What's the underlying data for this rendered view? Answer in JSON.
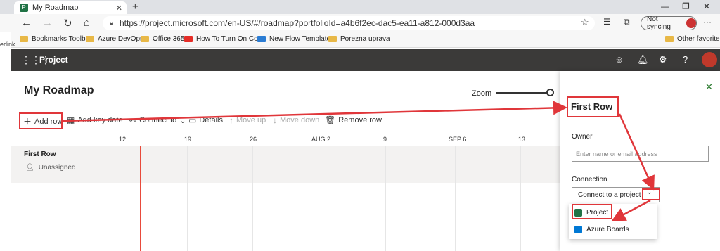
{
  "browser": {
    "tab_title": "My Roadmap",
    "tab_close": "✕",
    "new_tab": "+",
    "url": "https://project.microsoft.com/en-US/#/roadmap?portfolioId=a4b6f2ec-dac5-ea11-a812-000d3aa",
    "sync_label": "Not syncing",
    "more": "···",
    "left_text": "erlink",
    "bookmarks": [
      "Bookmarks Toolbar",
      "Azure DevOps",
      "Office 365",
      "How To Turn On Co...",
      "New Flow Template...",
      "Porezna uprava"
    ],
    "other_favorites": "Other favorites"
  },
  "app": {
    "name": "Project",
    "waffle": "⋮⋮⋮"
  },
  "roadmap": {
    "title": "My Roadmap",
    "zoom_label": "Zoom",
    "zoom_level": 1.0,
    "toolbar": {
      "add_row": "Add row",
      "add_key_date": "Add key date",
      "connect_to": "Connect to",
      "details": "Details",
      "move_up": "Move up",
      "move_down": "Move down",
      "remove_row": "Remove row"
    },
    "dates": [
      "12",
      "19",
      "26",
      "AUG 2",
      "9",
      "SEP 6",
      "13"
    ],
    "row": {
      "name": "First Row",
      "owner": "Unassigned"
    }
  },
  "panel": {
    "row_name": "First Row",
    "owner_label": "Owner",
    "owner_placeholder": "Enter name or email address",
    "connection_label": "Connection",
    "connect_button": "Connect to a project",
    "options": [
      "Project",
      "Azure Boards"
    ]
  },
  "colors": {
    "annotation": "#e0363a",
    "header": "#3b3a39",
    "today_line": "#e84a3b"
  }
}
